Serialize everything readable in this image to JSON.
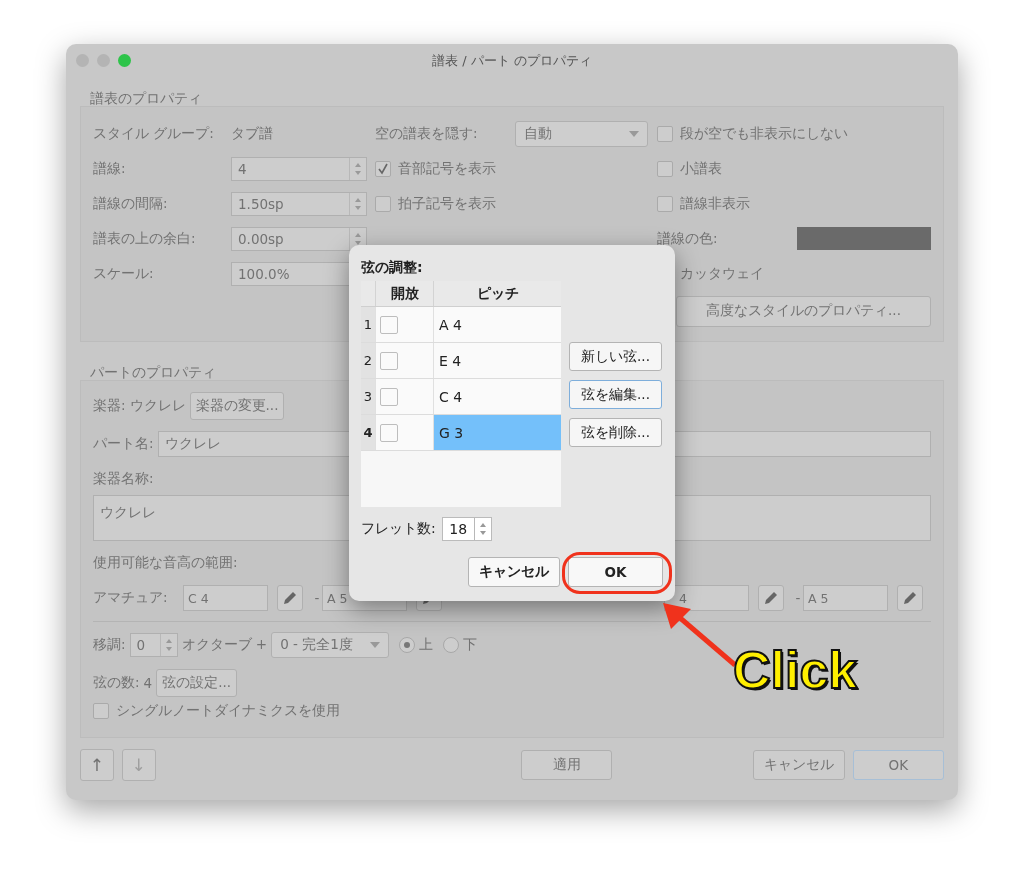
{
  "window": {
    "title": "譜表 / パート のプロパティ"
  },
  "staff_properties": {
    "title": "譜表のプロパティ",
    "style_group_label": "スタイル グループ:",
    "style_group_value": "タブ譜",
    "fields": [
      {
        "label": "譜線:",
        "value": "4",
        "spinner": true
      },
      {
        "label": "譜線の間隔:",
        "value": "1.50sp",
        "spinner": true
      },
      {
        "label": "譜表の上の余白:",
        "value": "0.00sp",
        "spinner": true
      },
      {
        "label": "スケール:",
        "value": "100.0%"
      }
    ],
    "hide_empty": {
      "label": "空の譜表を隠す:",
      "value": "自動"
    },
    "checkboxes_middle": [
      {
        "label": "音部記号を表示",
        "checked": true
      },
      {
        "label": "拍子記号を表示",
        "checked": false
      }
    ],
    "checkboxes_right": [
      {
        "label": "段が空でも非表示にしない",
        "checked": false
      },
      {
        "label": "小譜表",
        "checked": false
      },
      {
        "label": "譜線非表示",
        "checked": false
      }
    ],
    "line_color": {
      "label": "譜線の色:",
      "color": "#6a6a6a"
    },
    "cutaway_label": "カッタウェイ",
    "advanced_button": "高度なスタイルのプロパティ..."
  },
  "part_properties": {
    "title": "パートのプロパティ",
    "instrument_label": "楽器:",
    "instrument_value": "ウクレレ",
    "change_instrument_button": "楽器の変更...",
    "part_name": {
      "label": "パート名:",
      "value": "ウクレレ"
    },
    "long_name": {
      "label": "楽器名称:",
      "value": "ウクレレ"
    },
    "range_label": "使用可能な音高の範囲:",
    "amateur": {
      "label": "アマチュア:",
      "low": "C 4",
      "dash": "-",
      "high": "A 5"
    },
    "professional": {
      "low": "4",
      "dash": "-",
      "high": "A 5"
    },
    "transpose": {
      "label": "移調:",
      "value": "0",
      "octave_label": "オクターブ +",
      "interval": "0 - 完全1度",
      "directions": [
        {
          "label": "上",
          "selected": true
        },
        {
          "label": "下",
          "selected": false
        }
      ]
    },
    "strings": {
      "label": "弦の数:",
      "value": "4",
      "button": "弦の設定..."
    },
    "single_note": {
      "label": "シングルノートダイナミクスを使用",
      "checked": false
    }
  },
  "footer": {
    "move_buttons": [
      {
        "label": "↑",
        "disabled": false
      },
      {
        "label": "↓",
        "disabled": true
      }
    ],
    "apply": "適用",
    "cancel": "キャンセル",
    "ok": "OK"
  },
  "string_dialog": {
    "title": "弦の調整:",
    "columns": [
      "開放",
      "ピッチ"
    ],
    "rows": [
      {
        "number": "1",
        "open": false,
        "pitch": "A 4",
        "selected": false
      },
      {
        "number": "2",
        "open": false,
        "pitch": "E 4",
        "selected": false
      },
      {
        "number": "3",
        "open": false,
        "pitch": "C 4",
        "selected": false
      },
      {
        "number": "4",
        "open": false,
        "pitch": "G 3",
        "selected": true
      }
    ],
    "buttons": [
      {
        "label": "新しい弦...",
        "focused": false
      },
      {
        "label": "弦を編集...",
        "focused": true
      },
      {
        "label": "弦を削除...",
        "focused": false
      }
    ],
    "frets": {
      "label": "フレット数:",
      "value": "18"
    },
    "cancel": "キャンセル",
    "ok": "OK"
  },
  "annotation": {
    "text": "Click"
  }
}
